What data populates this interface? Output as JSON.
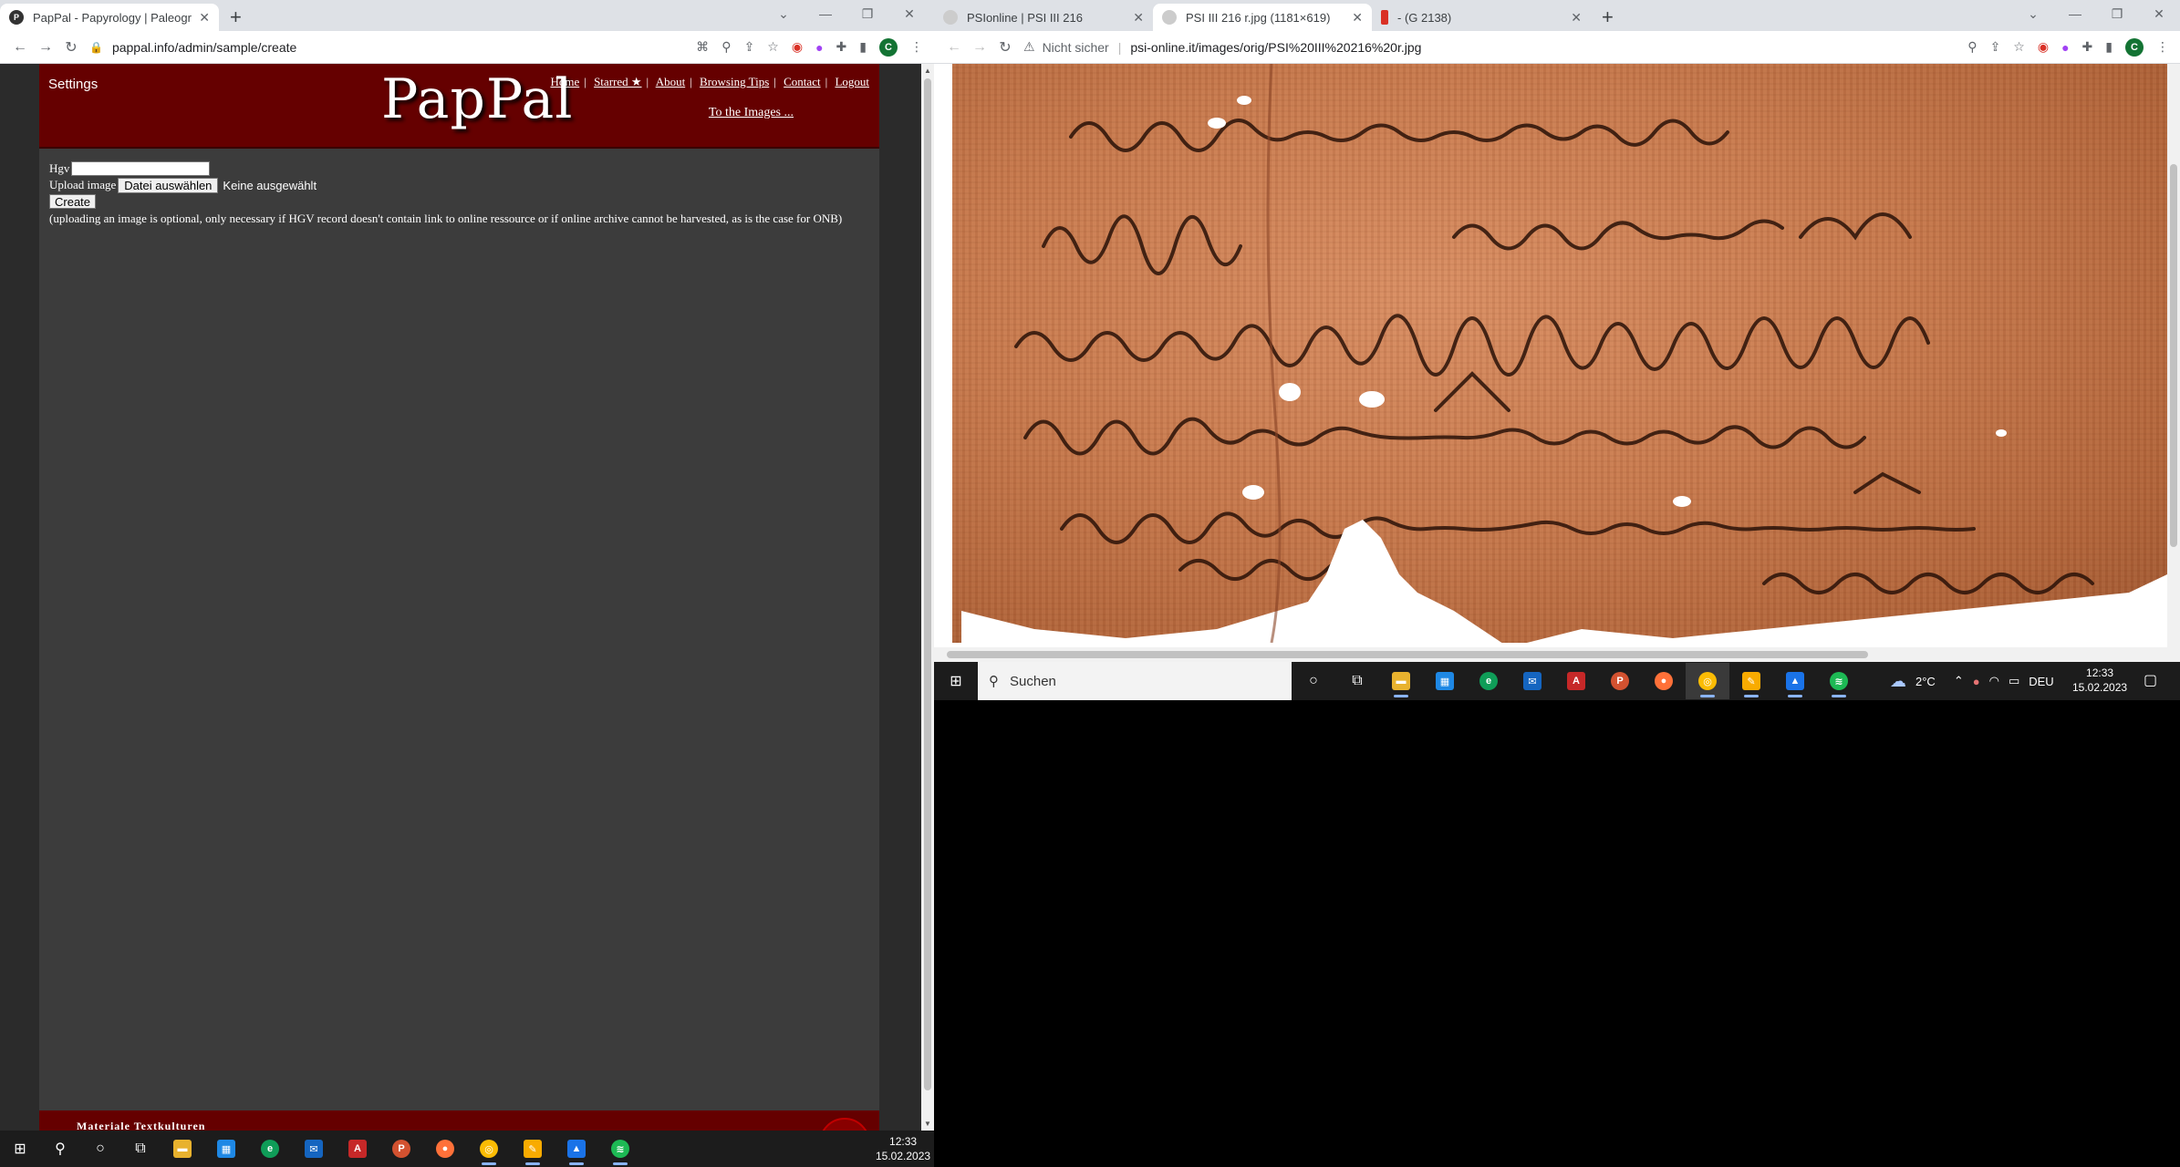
{
  "left_browser": {
    "tab": {
      "title": "PapPal - Papyrology | Paleograph",
      "favicon_letter": "P"
    },
    "url": "pappal.info/admin/sample/create",
    "profile_letter": "C"
  },
  "pappal": {
    "settings": "Settings",
    "logo": "PapPal",
    "nav": [
      "Home",
      "Starred ★",
      "About",
      "Browsing Tips",
      "Contact",
      "Logout"
    ],
    "to_images": "To the Images ...",
    "form": {
      "hgv_label": "Hgv",
      "upload_label": "Upload image",
      "file_button": "Datei auswählen",
      "no_file": "Keine ausgewählt",
      "create_button": "Create",
      "note": "(uploading an image is optional, only necessary if HGV record doesn't contain link to online ressource or if online archive cannot be harvested, as is the case for ONB)"
    },
    "footer_text": "Materiale Textkulturen"
  },
  "left_taskbar": {
    "time": "12:33",
    "date": "15.02.2023"
  },
  "right_browser": {
    "tabs": [
      {
        "title": "PSIonline | PSI III 216"
      },
      {
        "title": "PSI III 216 r.jpg (1181×619)"
      },
      {
        "title": "- (G 2138)"
      }
    ],
    "not_secure": "Nicht sicher",
    "url": "psi-online.it/images/orig/PSI%20III%20216%20r.jpg",
    "profile_letter": "C"
  },
  "right_taskbar": {
    "search_placeholder": "Suchen",
    "weather": "2°C",
    "language": "DEU",
    "time": "12:33",
    "date": "15.02.2023"
  },
  "colors": {
    "header_red": "#650000",
    "content_gray": "#3c3c3c",
    "papyrus": "#c77a4e"
  }
}
